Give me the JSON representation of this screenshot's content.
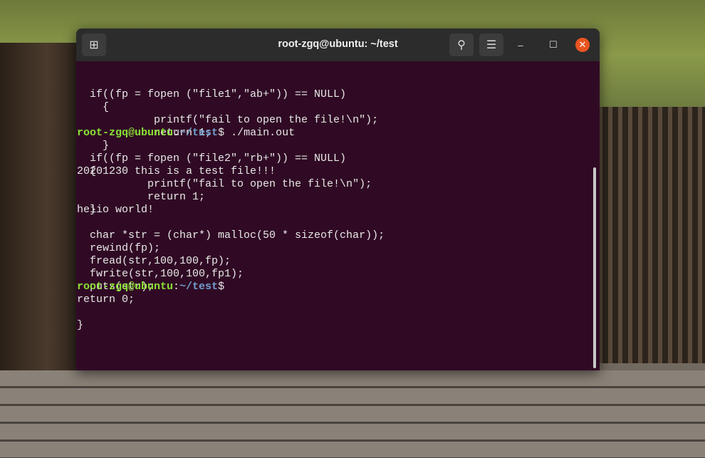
{
  "window": {
    "title": "root-zgq@ubuntu: ~/test"
  },
  "terminal": {
    "code_lines": [
      "  if((fp = fopen (\"file1\",\"ab+\")) == NULL)",
      "    {",
      "            printf(\"fail to open the file!\\n\");",
      "            return 1;",
      "    }",
      "  if((fp = fopen (\"file2\",\"rb+\")) == NULL)",
      "  {",
      "           printf(\"fail to open the file!\\n\");",
      "           return 1;",
      "  }",
      "",
      "  char *str = (char*) malloc(50 * sizeof(char));",
      "  rewind(fp);",
      "  fread(str,100,100,fp);",
      "  fwrite(str,100,100,fp1);",
      "  puts(str);",
      "return 0;",
      "",
      "}"
    ],
    "prompt": {
      "user": "root-zgq@ubuntu",
      "sep": ":",
      "path": "~/test",
      "symbol": "$"
    },
    "command": " ./main.out",
    "output": [
      "20201230 this is a test file!!!",
      "heiio world!",
      ""
    ]
  }
}
